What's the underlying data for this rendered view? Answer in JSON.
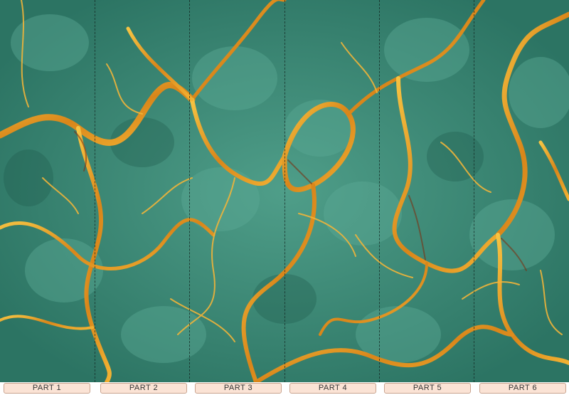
{
  "mural": {
    "panel_count": 6,
    "base_color": "#2f7e6c",
    "vein_color": "#e8a21f"
  },
  "panels": [
    {
      "label": "PART 1"
    },
    {
      "label": "PART 2"
    },
    {
      "label": "PART 3"
    },
    {
      "label": "PART 4"
    },
    {
      "label": "PART 5"
    },
    {
      "label": "PART 6"
    }
  ]
}
